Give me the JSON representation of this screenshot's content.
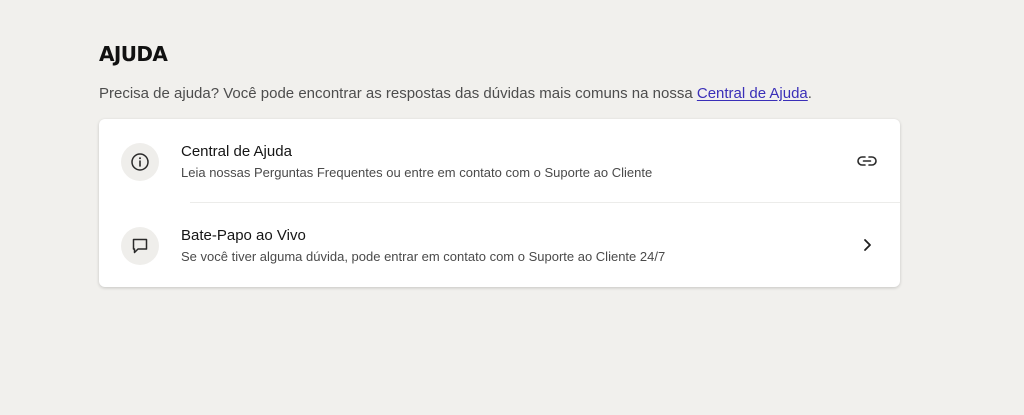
{
  "header": {
    "title": "AJUDA"
  },
  "intro": {
    "text_before": "Precisa de ajuda? Você pode encontrar as respostas das dúvidas mais comuns na nossa ",
    "link_text": "Central de Ajuda",
    "text_after": "."
  },
  "help_options": [
    {
      "title": "Central de Ajuda",
      "description": "Leia nossas Perguntas Frequentes ou entre em contato com o Suporte ao Cliente",
      "icon": "info-icon",
      "action_icon": "link-icon"
    },
    {
      "title": "Bate-Papo ao Vivo",
      "description": "Se você tiver alguma dúvida, pode entrar em contato com o Suporte ao Cliente 24/7",
      "icon": "chat-icon",
      "action_icon": "chevron-right-icon"
    }
  ],
  "colors": {
    "background": "#f1f0ed",
    "card": "#ffffff",
    "link": "#3a2fb8",
    "icon_circle": "#efeeeb"
  }
}
